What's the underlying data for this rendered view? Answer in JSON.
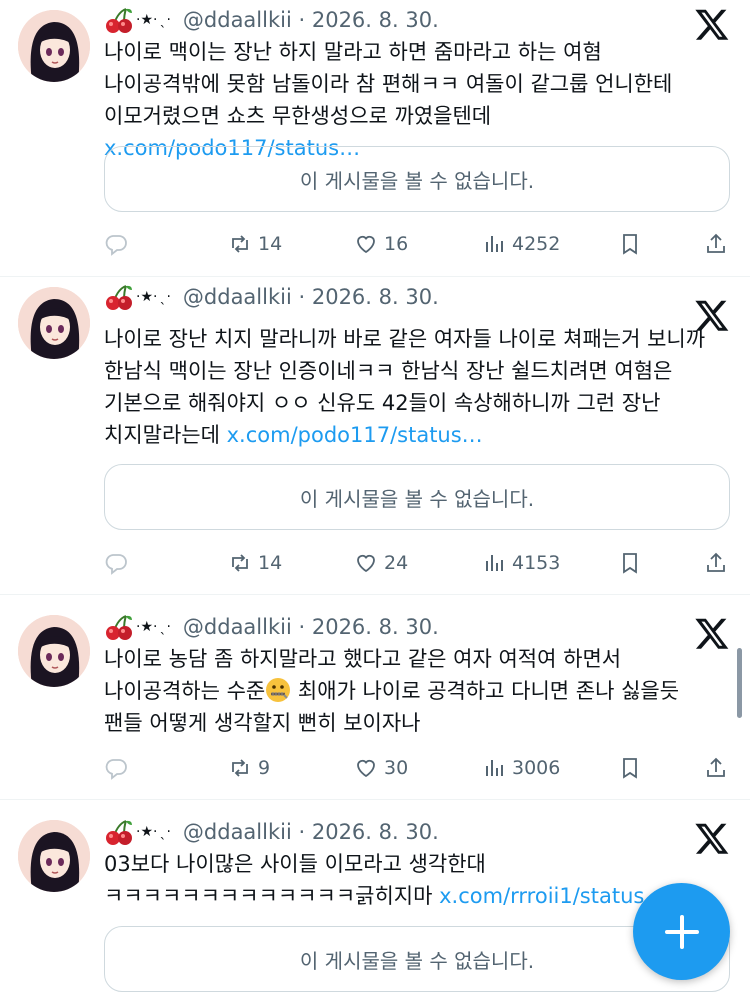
{
  "colors": {
    "accent": "#1d9bf0",
    "secondary_text": "#536471",
    "border": "#cfd9de"
  },
  "tweets": [
    {
      "handle": "@ddaallkii",
      "date": "2026. 8. 30.",
      "name_icons": [
        "cherry-icon",
        "star-icon",
        "sparkle-icon"
      ],
      "text": "나이로 맥이는 장난 하지 말라고 하면 줌마라고 하는 여혐 나이공격밖에 못함 남돌이라 참 편해ㅋㅋ 여돌이 같그룹 언니한테 이모거렸으면 쇼츠 무한생성으로 까였을텐데 ",
      "link": "x.com/podo117/status…",
      "unavailable": "이 게시물을 볼 수 없습니다.",
      "reposts": "14",
      "likes": "16",
      "views": "4252"
    },
    {
      "handle": "@ddaallkii",
      "date": "2026. 8. 30.",
      "name_icons": [
        "cherry-icon",
        "star-icon",
        "sparkle-icon"
      ],
      "text": "나이로 장난 치지 말라니까 바로 같은 여자들 나이로 쳐패는거 보니까 한남식 맥이는 장난 인증이네ㅋㅋ 한남식 장난 쉴드치려면 여혐은 기본으로 해줘야지 ㅇㅇ 신유도 42들이 속상해하니까 그런 장난 치지말라는데 ",
      "link": "x.com/podo117/status…",
      "unavailable": "이 게시물을 볼 수 없습니다.",
      "reposts": "14",
      "likes": "24",
      "views": "4153"
    },
    {
      "handle": "@ddaallkii",
      "date": "2026. 8. 30.",
      "name_icons": [
        "cherry-icon",
        "star-icon",
        "sparkle-icon"
      ],
      "text_before": "나이로 농담 좀 하지말라고 했다고 같은 여자 여적여 하면서 나이공격하는 수준",
      "emoji": "zipper-mouth-face-icon",
      "text_after": " 최애가 나이로 공격하고 다니면 존나 싫을듯 팬들 어떻게 생각할지 뻔히 보이자나",
      "reposts": "9",
      "likes": "30",
      "views": "3006"
    },
    {
      "handle": "@ddaallkii",
      "date": "2026. 8. 30.",
      "name_icons": [
        "cherry-icon",
        "star-icon",
        "sparkle-icon"
      ],
      "text": "03보다 나이많은 사이들 이모라고 생각한대 ㅋㅋㅋㅋㅋㅋㅋㅋㅋㅋㅋㅋㅋ긁히지마 ",
      "link": "x.com/rrroii1/status…",
      "unavailable": "이 게시물을 볼 수 없습니다."
    }
  ],
  "fab": {
    "icon": "plus-icon"
  }
}
